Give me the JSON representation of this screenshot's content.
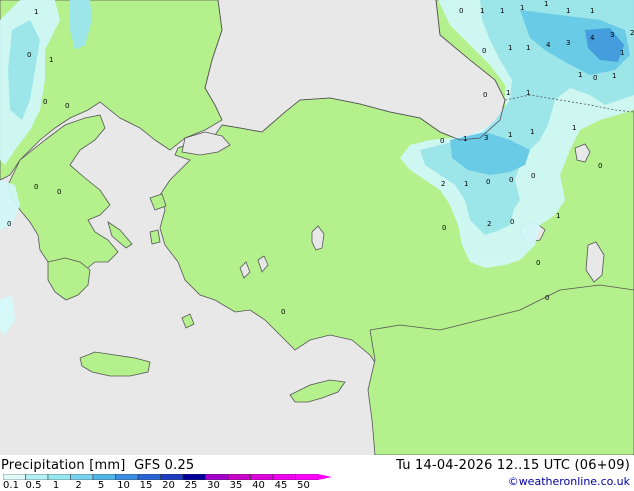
{
  "product": {
    "title": "Precipitation [mm]",
    "model": "GFS 0.25",
    "valid_time": "Tu 14-04-2026 12..15 UTC (06+09)",
    "credit": "©weatheronline.co.uk"
  },
  "legend": {
    "levels": [
      "0.1",
      "0.5",
      "1",
      "2",
      "5",
      "10",
      "15",
      "20",
      "25",
      "30",
      "35",
      "40",
      "45",
      "50"
    ],
    "colors": [
      "#e0fafa",
      "#b4f0f4",
      "#96e6f0",
      "#78d2ee",
      "#50b4e6",
      "#3c8ce0",
      "#2864d2",
      "#1e3cbe",
      "#000096",
      "#a000c8",
      "#c800c8",
      "#dc00dc",
      "#f000f0",
      "#ff00ff"
    ]
  },
  "colors": {
    "land": "#b4f08c",
    "sea": "#e8e8e8",
    "coast": "#555555",
    "rain_light": "#d2f8fa",
    "rain_medium": "#9be6f2",
    "rain_heavy": "#64c8ee",
    "rain_max": "#3c96e4"
  },
  "map_labels": [
    "1",
    "0",
    "1",
    "0",
    "0",
    "0",
    "0",
    "0",
    "0",
    "1",
    "1",
    "1",
    "1",
    "1",
    "1",
    "1",
    "1",
    "4",
    "3",
    "4",
    "3",
    "2",
    "0",
    "1",
    "1",
    "0",
    "1",
    "1",
    "1",
    "1",
    "1",
    "0",
    "0",
    "3",
    "1",
    "0",
    "1",
    "0",
    "2",
    "1",
    "0",
    "0",
    "0",
    "0",
    "2",
    "0",
    "1",
    "0",
    "0"
  ]
}
